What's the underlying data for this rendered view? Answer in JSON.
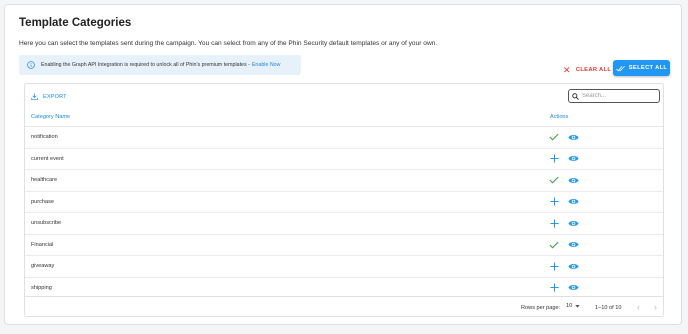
{
  "page": {
    "title": "Template Categories",
    "description": "Here you can select the templates sent during the campaign. You can select from any of the Phin Security default templates or any of your own."
  },
  "banner": {
    "text": "Enabling the Graph API Integration is required to unlock all of Phin's premium templates -",
    "link": "Enable Now",
    "icon": "info-icon"
  },
  "toolbar": {
    "clear_all": "CLEAR ALL",
    "select_all": "SELECT ALL",
    "export": "EXPORT",
    "search_placeholder": "Search..."
  },
  "table": {
    "columns": [
      "Category Name",
      "Actions"
    ],
    "rows": [
      {
        "name": "notification",
        "selected": true
      },
      {
        "name": "current event",
        "selected": false
      },
      {
        "name": "healthcare",
        "selected": true
      },
      {
        "name": "purchase",
        "selected": false
      },
      {
        "name": "unsubscribe",
        "selected": false
      },
      {
        "name": "Financial",
        "selected": true
      },
      {
        "name": "giveaway",
        "selected": false
      },
      {
        "name": "shipping",
        "selected": false
      }
    ]
  },
  "pagination": {
    "rows_per_page_label": "Rows per page:",
    "rows_per_page_value": "10",
    "range": "1–10 of 10",
    "prev": "‹",
    "next": "›"
  },
  "colors": {
    "accent": "#2196f3",
    "danger": "#e53935",
    "success": "#43a047",
    "banner_bg": "#e6f1fb"
  }
}
